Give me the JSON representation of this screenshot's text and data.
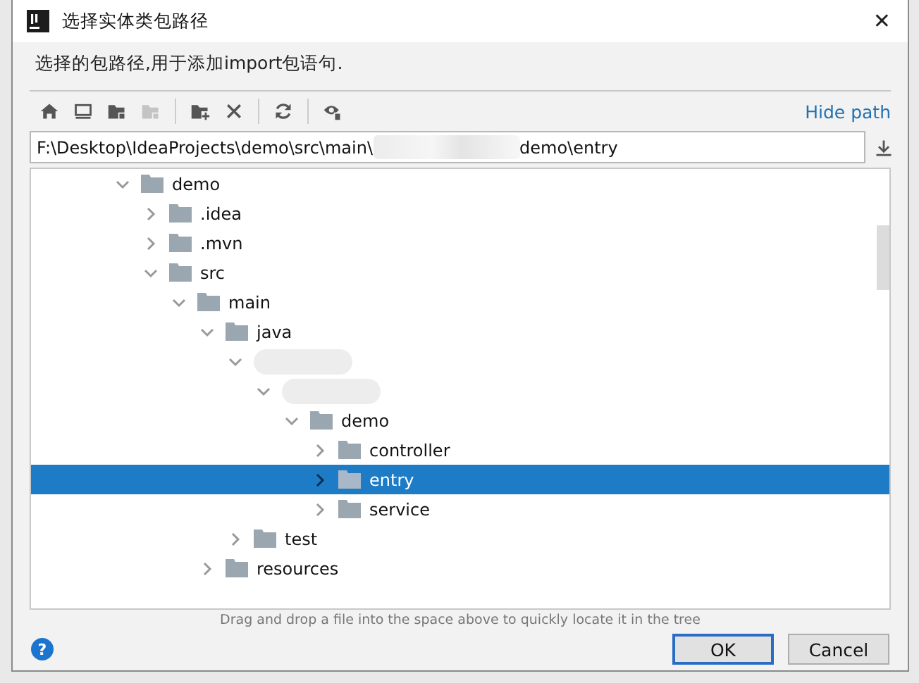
{
  "window": {
    "title": "选择实体类包路径",
    "close": "✕"
  },
  "description": "选择的包路径,用于添加import包语句.",
  "toolbar": {
    "hide_path": "Hide path"
  },
  "path_field": {
    "value_start": "F:\\Desktop\\IdeaProjects\\demo\\src\\main\\",
    "value_end": "demo\\entry",
    "redacted": true
  },
  "tree": [
    {
      "label": "demo",
      "expanded": true,
      "selected": false,
      "children": [
        {
          "label": ".idea",
          "expanded": false,
          "selected": false
        },
        {
          "label": ".mvn",
          "expanded": false,
          "selected": false
        },
        {
          "label": "src",
          "expanded": true,
          "selected": false,
          "children": [
            {
              "label": "main",
              "expanded": true,
              "selected": false,
              "children": [
                {
                  "label": "java",
                  "expanded": true,
                  "selected": false,
                  "children": [
                    {
                      "kind": "redacted",
                      "expanded": true,
                      "selected": false,
                      "children": [
                        {
                          "kind": "redacted",
                          "expanded": true,
                          "selected": false,
                          "children": [
                            {
                              "label": "demo",
                              "expanded": true,
                              "selected": false,
                              "children": [
                                {
                                  "label": "controller",
                                  "expanded": false,
                                  "selected": false
                                },
                                {
                                  "label": "entry",
                                  "expanded": false,
                                  "selected": true
                                },
                                {
                                  "label": "service",
                                  "expanded": false,
                                  "selected": false
                                }
                              ]
                            }
                          ]
                        }
                      ]
                    },
                    {
                      "label": "test",
                      "expanded": false,
                      "selected": false
                    }
                  ]
                },
                {
                  "label": "resources",
                  "expanded": false,
                  "selected": false
                }
              ]
            }
          ]
        }
      ]
    }
  ],
  "hint": "Drag and drop a file into the space above to quickly locate it in the tree",
  "help": "?",
  "buttons": [
    {
      "label": "OK",
      "default": true
    },
    {
      "label": "Cancel",
      "default": false
    }
  ]
}
